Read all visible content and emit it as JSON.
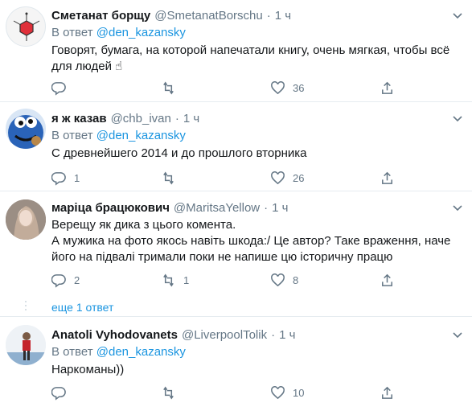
{
  "tweets": [
    {
      "name": "Сметанат борщу",
      "handle": "@SmetanatBorschu",
      "time": "1 ч",
      "reply_prefix": "В ответ",
      "reply_to": "@den_kazansky",
      "text_lines": [
        "Говорят, бумага, на которой напечатали книгу, очень мягкая, чтобы всё",
        "для людей ☝"
      ],
      "replies": "",
      "retweets": "",
      "likes": "36"
    },
    {
      "name": "я ж казав",
      "handle": "@chb_ivan",
      "time": "1 ч",
      "reply_prefix": "В ответ",
      "reply_to": "@den_kazansky",
      "text_lines": [
        "С древнейшего 2014 и до прошлого вторника"
      ],
      "replies": "1",
      "retweets": "",
      "likes": "26"
    },
    {
      "name": "маріца брацюкович",
      "handle": "@MaritsaYellow",
      "time": "1 ч",
      "text_lines": [
        "Верещу як дика з цього комента.",
        "А мужика на фото якось навіть шкода:/ Це автор? Таке враження, наче",
        "його на підвалі тримали поки не напише цю історичну працю"
      ],
      "replies": "2",
      "retweets": "1",
      "likes": "8"
    },
    {
      "name": "Anatoli Vyhodovanets",
      "handle": "@LiverpoolTolik",
      "time": "1 ч",
      "reply_prefix": "В ответ",
      "reply_to": "@den_kazansky",
      "text_lines": [
        "Наркоманы))"
      ],
      "replies": "",
      "retweets": "",
      "likes": "10"
    }
  ],
  "more_replies": "еще 1 ответ",
  "separator": "·",
  "icons": {
    "reply": "reply-icon",
    "retweet": "retweet-icon",
    "like": "heart-icon",
    "share": "share-icon",
    "menu": "chevron-down-icon"
  },
  "colors": {
    "link": "#1b95e0",
    "muted": "#657786",
    "text": "#14171a",
    "border": "#e6ecf0"
  }
}
